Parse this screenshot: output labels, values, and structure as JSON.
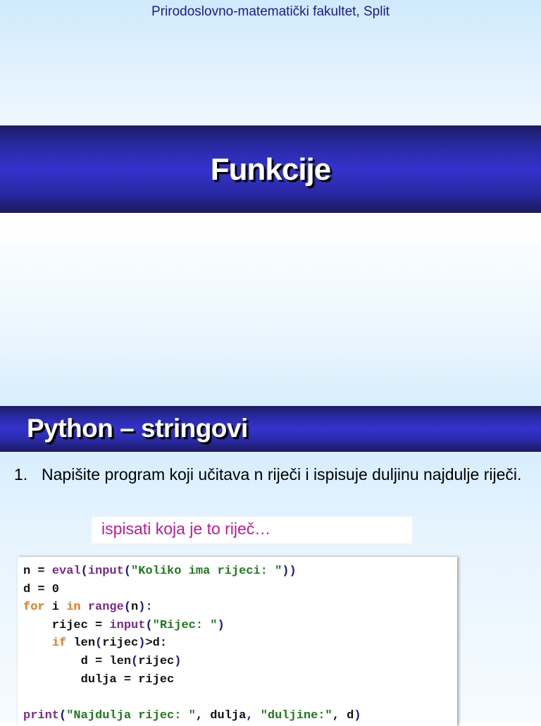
{
  "slide1": {
    "institution": "Prirodoslovno-matematički fakultet, Split",
    "title": "Funkcije"
  },
  "slide2": {
    "title": "Python – stringovi",
    "task_number": "1.",
    "task_text": "Napišite program koji učitava n riječi i ispisuje duljinu najdulje riječi.",
    "hint": "ispisati koja je to riječ…",
    "code": [
      [
        [
          "n = ",
          ""
        ],
        [
          "eval",
          "bi"
        ],
        [
          "(",
          "pn"
        ],
        [
          "input",
          "bi"
        ],
        [
          "(",
          "pn"
        ],
        [
          "\"Koliko ima rijeci: \"",
          "st"
        ],
        [
          "))",
          "pn"
        ]
      ],
      [
        [
          "d = 0",
          ""
        ]
      ],
      [
        [
          "for",
          "kw"
        ],
        [
          " i ",
          ""
        ],
        [
          "in",
          "kw"
        ],
        [
          " ",
          ""
        ],
        [
          "range",
          "bi"
        ],
        [
          "(",
          "pn"
        ],
        [
          "n",
          ""
        ],
        [
          "):",
          "pn"
        ]
      ],
      [
        [
          "    rijec = ",
          ""
        ],
        [
          "input",
          "bi"
        ],
        [
          "(",
          "pn"
        ],
        [
          "\"Rijec: \"",
          "st"
        ],
        [
          ")",
          "pn"
        ]
      ],
      [
        [
          "    ",
          ""
        ],
        [
          "if",
          "kw"
        ],
        [
          " len",
          ""
        ],
        [
          "(",
          "pn"
        ],
        [
          "rijec",
          ""
        ],
        [
          ")",
          "pn"
        ],
        [
          ">d:",
          ""
        ]
      ],
      [
        [
          "        d = len",
          ""
        ],
        [
          "(",
          "pn"
        ],
        [
          "rijec",
          ""
        ],
        [
          ")",
          "pn"
        ]
      ],
      [
        [
          "        dulja = rijec",
          ""
        ]
      ],
      [
        [
          "",
          ""
        ]
      ],
      [
        [
          "print",
          "bi"
        ],
        [
          "(",
          "pn"
        ],
        [
          "\"Najdulja rijec: \"",
          "st"
        ],
        [
          ", dulja",
          ""
        ],
        [
          ", ",
          "pn"
        ],
        [
          "\"duljine:\"",
          "st"
        ],
        [
          ", d",
          ""
        ],
        [
          ")",
          "pn"
        ]
      ]
    ]
  }
}
